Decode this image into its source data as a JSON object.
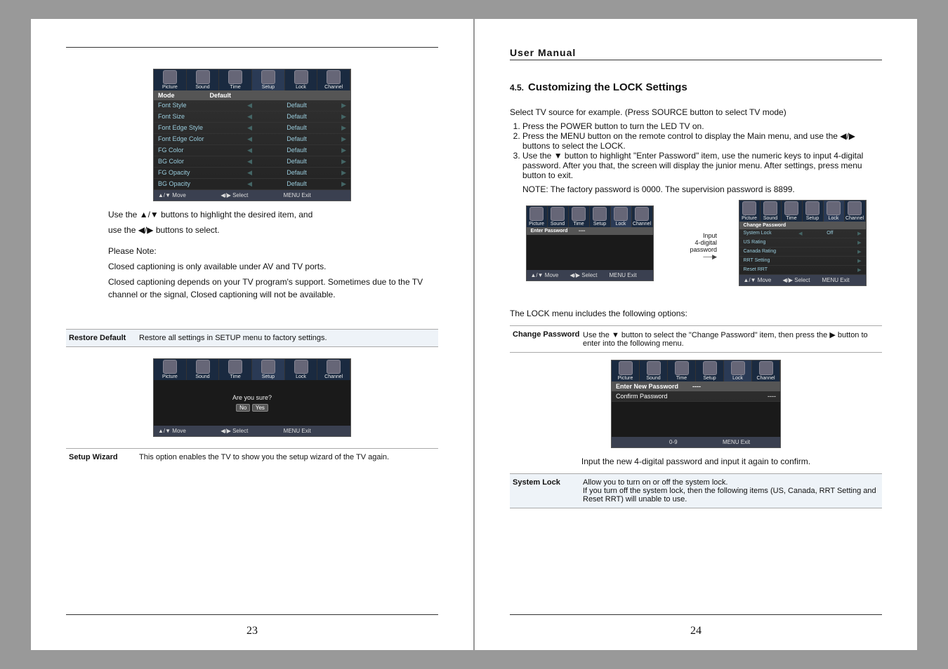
{
  "left": {
    "pageno": "23",
    "osd1": {
      "tabs": [
        "Picture",
        "Sound",
        "Time",
        "Setup",
        "Lock",
        "Channel"
      ],
      "header": "Mode",
      "headerVal": "Default",
      "rows": [
        {
          "label": "Font Style",
          "val": "Default"
        },
        {
          "label": "Font Size",
          "val": "Default"
        },
        {
          "label": "Font Edge Style",
          "val": "Default"
        },
        {
          "label": "Font Edge Color",
          "val": "Default"
        },
        {
          "label": "FG Color",
          "val": "Default"
        },
        {
          "label": "BG Color",
          "val": "Default"
        },
        {
          "label": "FG Opacity",
          "val": "Default"
        },
        {
          "label": "BG Opacity",
          "val": "Default"
        }
      ],
      "bottom": {
        "move": "▲/▼ Move",
        "select": "◀/▶ Select",
        "exit": "MENU Exit"
      }
    },
    "txt1a": "Use the ▲/▼ buttons to highlight the desired item, and",
    "txt1b": "use the ◀/▶ buttons to select.",
    "noteHdr": "Please Note:",
    "note1": "Closed captioning is only available under AV and TV ports.",
    "note2": "Closed captioning depends on your TV program's support. Sometimes due to the TV channel or the signal, Closed captioning will not be available.",
    "restore": {
      "k": "Restore Default",
      "v": "Restore all settings in SETUP menu to factory settings."
    },
    "osd2": {
      "tabs": [
        "Picture",
        "Sound",
        "Time",
        "Setup",
        "Lock",
        "Channel"
      ],
      "msg": "Are you sure?",
      "no": "No",
      "yes": "Yes",
      "bottom": {
        "move": "▲/▼ Move",
        "select": "◀/▶ Select",
        "exit": "MENU Exit"
      }
    },
    "wizard": {
      "k": "Setup Wizard",
      "v": "This option enables the TV to show you the setup wizard of the TV again."
    }
  },
  "right": {
    "pageno": "24",
    "pagetitle": "User Manual",
    "secnum": "4.5.",
    "sectitle": "Customizing the LOCK Settings",
    "intro": "Select TV source for example. (Press SOURCE button to select TV mode)",
    "step1": "Press the POWER button to turn the LED TV on.",
    "step2": "Press the MENU button on the remote control to display the Main menu, and use the ◀/▶ buttons to select the LOCK.",
    "step3": "Use the ▼ button to highlight \"Enter Password\" item, use the numeric keys to input 4-digital password. After you that, the screen will display the junior menu. After settings, press menu button to exit.",
    "step3note": "NOTE: The factory password is 0000. The supervision password is 8899.",
    "osdL": {
      "tabs": [
        "Picture",
        "Sound",
        "Time",
        "Setup",
        "Lock",
        "Channel"
      ],
      "row": "Enter Password",
      "dots": "----",
      "bottom": {
        "move": "▲/▼ Move",
        "select": "◀/▶ Select",
        "exit": "MENU Exit"
      }
    },
    "ann1": "Input",
    "ann2": "4-digital password",
    "osdR": {
      "tabs": [
        "Picture",
        "Sound",
        "Time",
        "Setup",
        "Lock",
        "Channel"
      ],
      "hdr": "Change Password",
      "rows": [
        {
          "label": "System Lock",
          "val": "Off"
        },
        {
          "label": "US Rating"
        },
        {
          "label": "Canada Rating"
        },
        {
          "label": "RRT Setting"
        },
        {
          "label": "Reset RRT"
        }
      ],
      "bottom": {
        "move": "▲/▼ Move",
        "select": "◀/▶ Select",
        "exit": "MENU Exit"
      }
    },
    "optline": "The LOCK menu includes the following options:",
    "changepw": {
      "k": "Change Password",
      "v": "Use the ▼ button to select the \"Change Password\" item, then press the ▶ button to enter into the following menu."
    },
    "osd3": {
      "tabs": [
        "Picture",
        "Sound",
        "Time",
        "Setup",
        "Lock",
        "Channel"
      ],
      "r1": "Enter New Password",
      "d1": "----",
      "r2": "Confirm Password",
      "d2": "----",
      "bottom": {
        "num": "0-9",
        "exit": "MENU Exit"
      }
    },
    "confirm": "Input the new 4-digital password and input it again to confirm.",
    "syslock": {
      "k": "System Lock",
      "v1": "Allow you to turn on or off the system lock.",
      "v2": "If you turn off the system lock, then the following items (US, Canada, RRT Setting and Reset RRT) will unable to use."
    }
  }
}
